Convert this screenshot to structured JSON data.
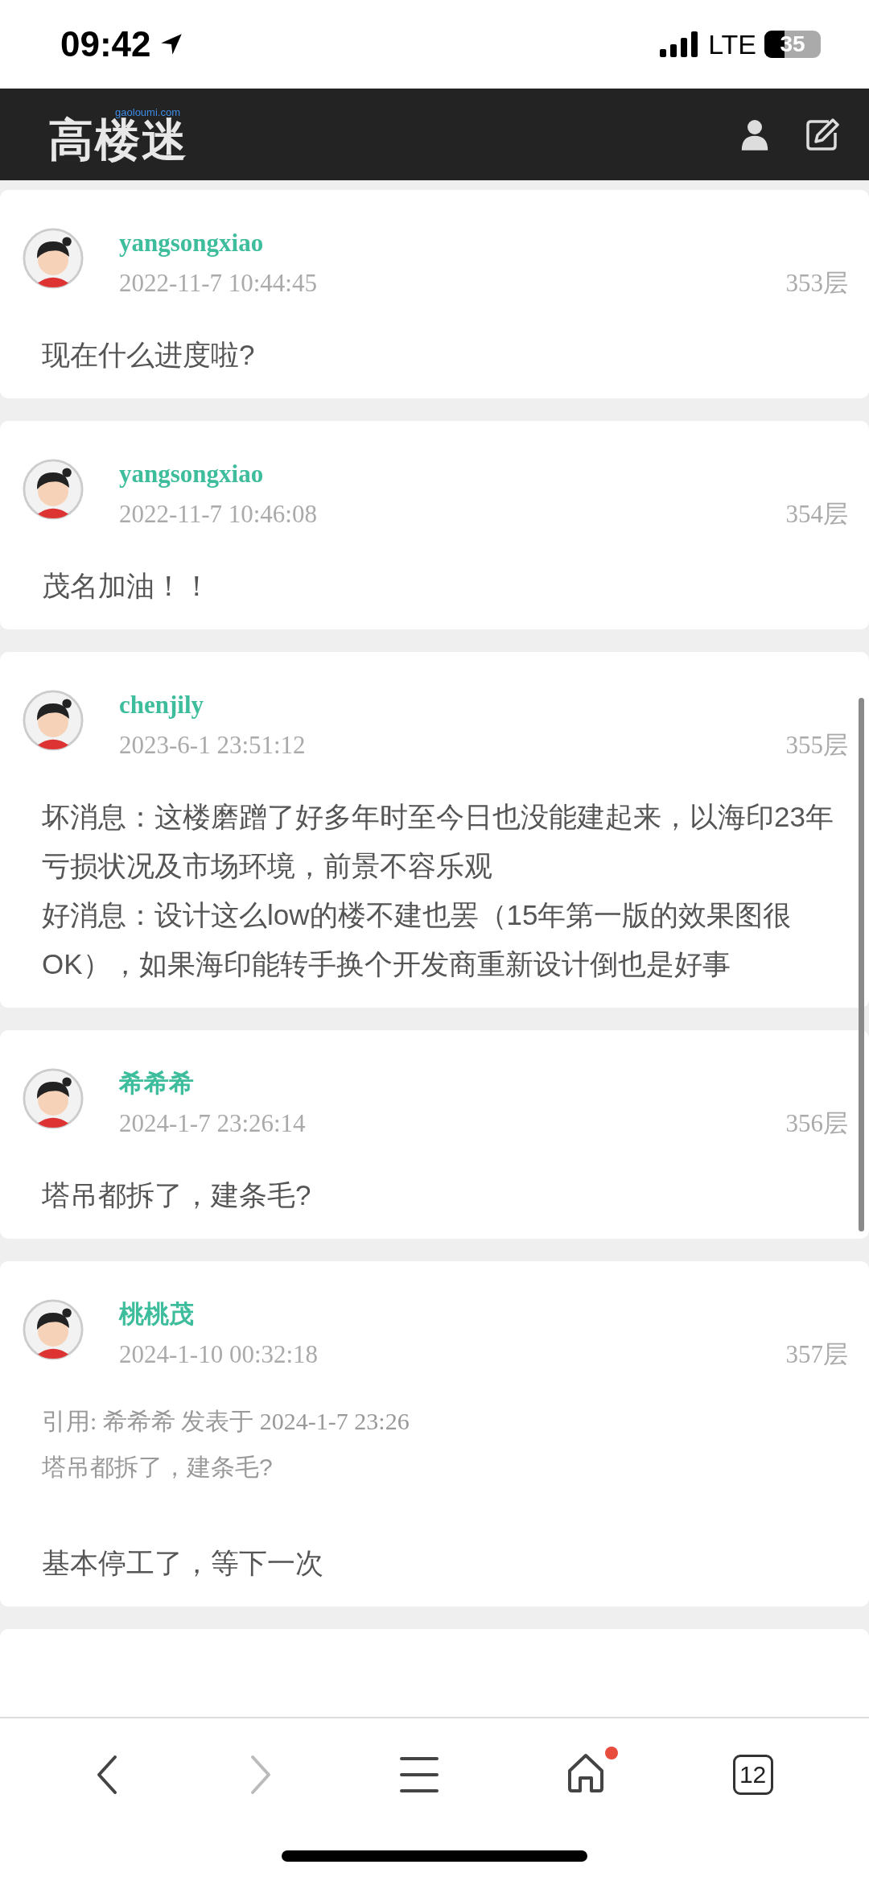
{
  "status_bar": {
    "time": "09:42",
    "network": "LTE",
    "battery": "35"
  },
  "header": {
    "logo_text": "高楼迷",
    "logo_domain": "gaoloumi.com"
  },
  "posts": [
    {
      "kind": "plain",
      "author": "yangsongxiao",
      "date": "2022-11-7 10:44:45",
      "floor": "353层",
      "content": [
        "现在什么进度啦?"
      ]
    },
    {
      "kind": "plain",
      "author": "yangsongxiao",
      "date": "2022-11-7 10:46:08",
      "floor": "354层",
      "content": [
        "茂名加油！！"
      ]
    },
    {
      "kind": "plain",
      "author": "chenjily",
      "date": "2023-6-1 23:51:12",
      "floor": "355层",
      "content": [
        "坏消息：这楼磨蹭了好多年时至今日也没能建起来，以海印23年亏损状况及市场环境，前景不容乐观",
        "好消息：设计这么low的楼不建也罢（15年第一版的效果图很OK），如果海印能转手换个开发商重新设计倒也是好事"
      ]
    },
    {
      "kind": "plain",
      "author": "希希希",
      "date": "2024-1-7 23:26:14",
      "floor": "356层",
      "content": [
        "塔吊都拆了，建条毛?"
      ]
    },
    {
      "kind": "quote",
      "author": "桃桃茂",
      "date": "2024-1-10 00:32:18",
      "floor": "357层",
      "quote_header": "引用: 希希希 发表于 2024-1-7 23:26",
      "quote_text": "塔吊都拆了，建条毛?",
      "content": [
        "基本停工了，等下一次"
      ]
    }
  ],
  "toolbar": {
    "back_disabled": false,
    "forward_disabled": true,
    "home_badge": true,
    "tab_count": "12"
  }
}
